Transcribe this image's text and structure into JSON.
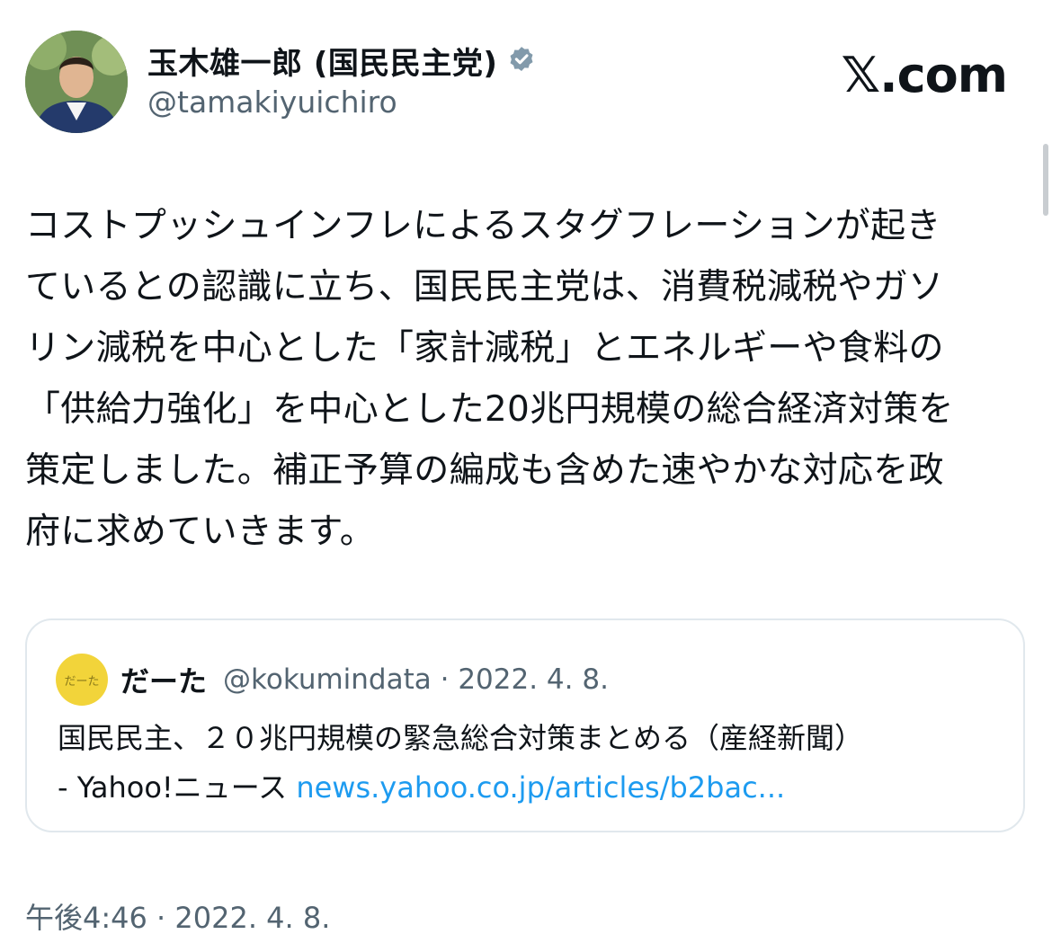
{
  "author": {
    "display_name": "玉木雄一郎 (国民民主党)",
    "handle": "@tamakiyuichiro",
    "verified_icon": "verified-badge-icon",
    "avatar": "avatar-photo"
  },
  "brand": {
    "label": "𝕏.com"
  },
  "tweet": {
    "text": "コストプッシュインフレによるスタグフレーションが起き\nているとの認識に立ち、国民民主党は、消費税減税やガソ\nリン減税を中心とした「家計減税」とエネルギーや食料の\n「供給力強化」を中心とした20兆円規模の総合経済対策を\n策定しました。補正予算の編成も含めた速やかな対応を政\n府に求めていきます。",
    "timestamp": "午後4:46 · 2022. 4. 8."
  },
  "quote": {
    "avatar_label": "だーた",
    "name": "だーた",
    "meta": "@kokumindata · 2022. 4. 8.",
    "text_line1": "国民民主、２０兆円規模の緊急総合対策まとめる（産経新聞）",
    "text_line2_prefix": "- Yahoo!ニュース ",
    "link": "news.yahoo.co.jp/articles/b2bac..."
  },
  "colors": {
    "text": "#0f1419",
    "secondary": "#536471",
    "link": "#1d9bf0",
    "verified": "#829aab",
    "quote_avatar_bg": "#f2d43a"
  }
}
